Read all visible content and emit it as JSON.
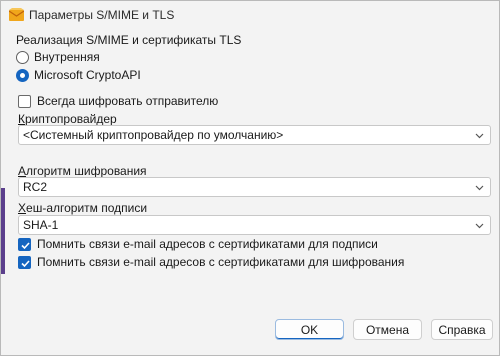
{
  "window": {
    "title": "Параметры S/MIME и TLS",
    "accent_color": "#1565c0",
    "app_icon": "outlook-envelope-icon"
  },
  "implementation": {
    "group_title": "Реализация S/MIME и сертификаты TLS",
    "options": [
      {
        "label": "Внутренняя",
        "selected": false
      },
      {
        "label": "Microsoft CryptoAPI",
        "selected": true
      }
    ]
  },
  "always_encrypt": {
    "label": "Всегда шифровать отправителю",
    "checked": false
  },
  "crypto_provider": {
    "label": "Криптопровайдер",
    "value": "<Системный криптопровайдер по умолчанию>"
  },
  "encryption_algorithm": {
    "label": "Алгоритм шифрования",
    "value": "RC2"
  },
  "hash_algorithm": {
    "label": "Хеш-алгоритм подписи",
    "value": "SHA-1"
  },
  "remember_signing": {
    "label": "Помнить связи e-mail адресов с сертификатами для подписи",
    "checked": true
  },
  "remember_encryption": {
    "label": "Помнить связи e-mail адресов с сертификатами для шифрования",
    "checked": true
  },
  "buttons": {
    "ok": "OK",
    "cancel": "Отмена",
    "help": "Справка"
  }
}
